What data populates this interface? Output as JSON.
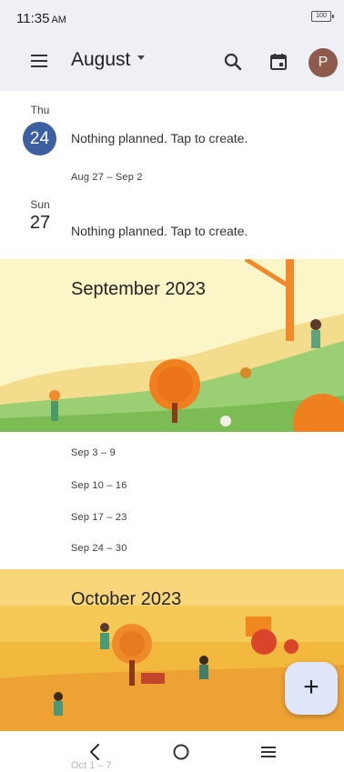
{
  "status_bar": {
    "time": "11:35",
    "ampm": "AM",
    "battery": "100"
  },
  "app_bar": {
    "month": "August",
    "avatar_initial": "P",
    "icons": [
      "menu-icon",
      "search-icon",
      "calendar-today-icon",
      "avatar"
    ]
  },
  "schedule": {
    "days": [
      {
        "weekday": "Thu",
        "date": "24",
        "today": true,
        "text": "Nothing planned. Tap to create."
      },
      {
        "weekday": "Sun",
        "date": "27",
        "today": false,
        "text": "Nothing planned. Tap to create."
      }
    ],
    "week_ranges": {
      "aug": "Aug 27 – Sep 2",
      "sep": [
        "Sep 3 – 9",
        "Sep 10 – 16",
        "Sep 17 – 23",
        "Sep 24 – 30"
      ],
      "oct_partial": "Oct 1 – 7"
    },
    "banners": {
      "september": "September 2023",
      "october": "October 2023"
    }
  },
  "fab": {
    "label": "+",
    "icon": "plus-icon"
  },
  "nav_bar": {
    "icons": [
      "back-icon",
      "home-icon",
      "recents-icon"
    ]
  },
  "colors": {
    "accent": "#3c5fa1",
    "app_bar_bg": "#eef0f5",
    "fab_bg": "#dfe6fa",
    "avatar_bg": "#8d5a4c"
  }
}
